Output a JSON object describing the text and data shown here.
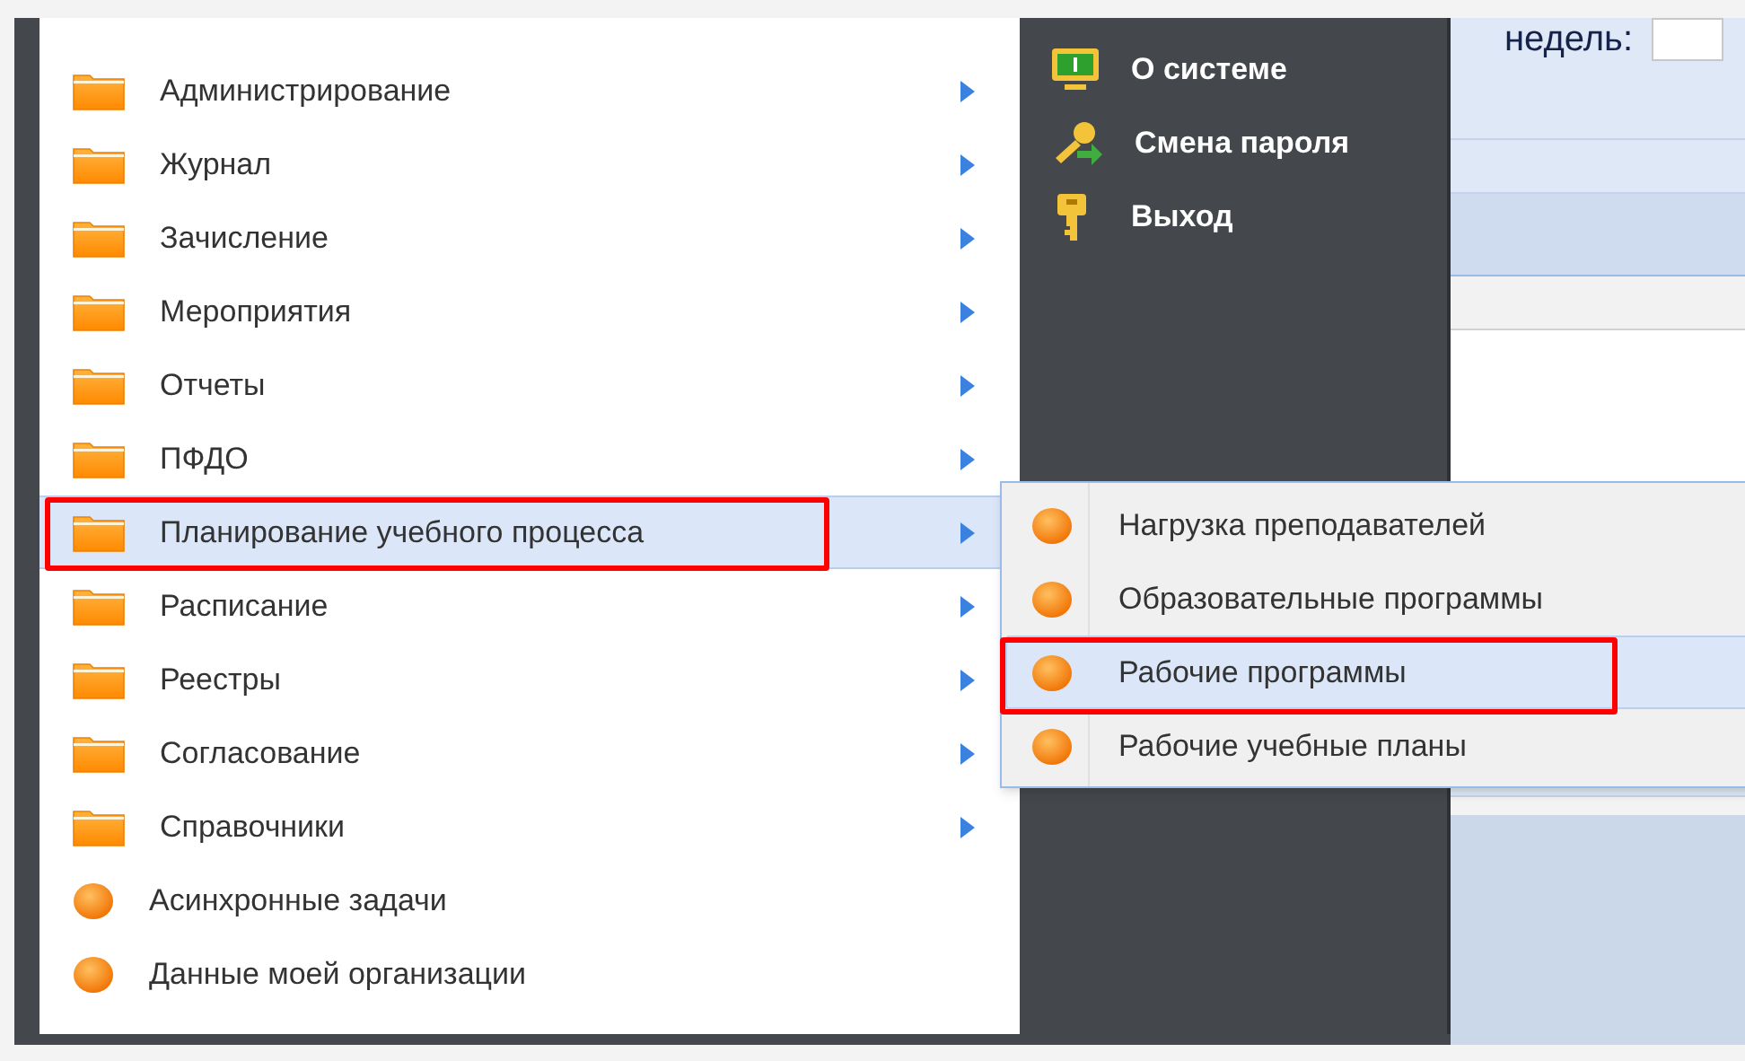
{
  "menu": {
    "items": [
      {
        "label": "Администрирование",
        "kind": "folder",
        "selected": false,
        "annotated": false
      },
      {
        "label": "Журнал",
        "kind": "folder",
        "selected": false,
        "annotated": false
      },
      {
        "label": "Зачисление",
        "kind": "folder",
        "selected": false,
        "annotated": false
      },
      {
        "label": "Мероприятия",
        "kind": "folder",
        "selected": false,
        "annotated": false
      },
      {
        "label": "Отчеты",
        "kind": "folder",
        "selected": false,
        "annotated": false
      },
      {
        "label": "ПФДО",
        "kind": "folder",
        "selected": false,
        "annotated": false
      },
      {
        "label": "Планирование учебного процесса",
        "kind": "folder",
        "selected": true,
        "annotated": true
      },
      {
        "label": "Расписание",
        "kind": "folder",
        "selected": false,
        "annotated": false
      },
      {
        "label": "Реестры",
        "kind": "folder",
        "selected": false,
        "annotated": false
      },
      {
        "label": "Согласование",
        "kind": "folder",
        "selected": false,
        "annotated": false
      },
      {
        "label": "Справочники",
        "kind": "folder",
        "selected": false,
        "annotated": false
      },
      {
        "label": "Асинхронные задачи",
        "kind": "leaf",
        "selected": false,
        "annotated": false
      },
      {
        "label": "Данные моей организации",
        "kind": "leaf",
        "selected": false,
        "annotated": false
      }
    ]
  },
  "system_menu": {
    "items": [
      {
        "label": "О системе",
        "kind": "info"
      },
      {
        "label": "Смена пароля",
        "kind": "password"
      },
      {
        "label": "Выход",
        "kind": "exit"
      }
    ]
  },
  "submenu": {
    "items": [
      {
        "label": "Нагрузка преподавателей",
        "selected": false,
        "annotated": false
      },
      {
        "label": "Образовательные программы",
        "selected": false,
        "annotated": false
      },
      {
        "label": "Рабочие программы",
        "selected": true,
        "annotated": true
      },
      {
        "label": "Рабочие учебные планы",
        "selected": false,
        "annotated": false
      }
    ]
  },
  "background": {
    "weeks_label": "недель:"
  }
}
